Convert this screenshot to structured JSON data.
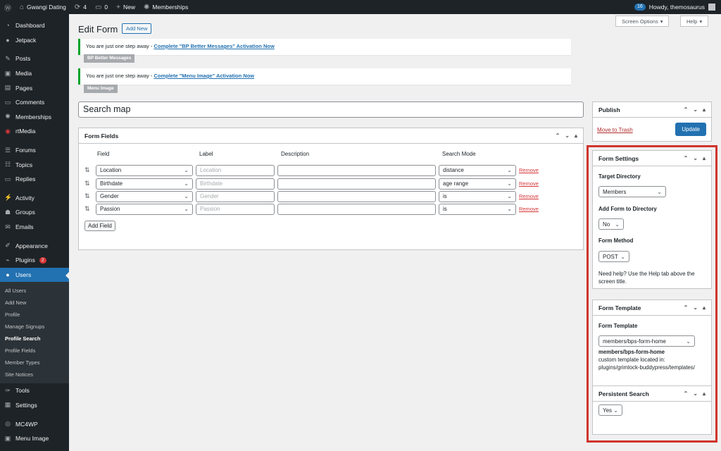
{
  "adminbar": {
    "site_name": "Gwangi Dating",
    "updates_count": "4",
    "comments_count": "0",
    "new_label": "New",
    "memberships_label": "Memberships",
    "notif_count": "16",
    "howdy": "Howdy, themosaurus"
  },
  "sidebar": {
    "items": [
      {
        "label": "Dashboard",
        "icon": "dashboard-icon"
      },
      {
        "label": "Jetpack",
        "icon": "jetpack-icon"
      },
      {
        "label": "Posts",
        "icon": "pin-icon"
      },
      {
        "label": "Media",
        "icon": "media-icon"
      },
      {
        "label": "Pages",
        "icon": "pages-icon"
      },
      {
        "label": "Comments",
        "icon": "comment-icon"
      },
      {
        "label": "Memberships",
        "icon": "memberships-icon"
      },
      {
        "label": "rtMedia",
        "icon": "rtmedia-icon"
      },
      {
        "label": "Forums",
        "icon": "forums-icon"
      },
      {
        "label": "Topics",
        "icon": "topics-icon"
      },
      {
        "label": "Replies",
        "icon": "replies-icon"
      },
      {
        "label": "Activity",
        "icon": "activity-icon"
      },
      {
        "label": "Groups",
        "icon": "groups-icon"
      },
      {
        "label": "Emails",
        "icon": "mail-icon"
      },
      {
        "label": "Appearance",
        "icon": "brush-icon"
      },
      {
        "label": "Plugins",
        "icon": "plugin-icon",
        "badge": "2"
      },
      {
        "label": "Users",
        "icon": "user-icon"
      }
    ],
    "submenu": [
      "All Users",
      "Add New",
      "Profile",
      "Manage Signups",
      "Profile Search",
      "Profile Fields",
      "Member Types",
      "Site Notices"
    ],
    "bottom": [
      {
        "label": "Tools",
        "icon": "wrench-icon"
      },
      {
        "label": "Settings",
        "icon": "settings-icon"
      },
      {
        "label": "MC4WP",
        "icon": "mc4wp-icon"
      },
      {
        "label": "Menu Image",
        "icon": "image-icon"
      }
    ]
  },
  "header": {
    "screen_options": "Screen Options",
    "help": "Help",
    "title": "Edit Form",
    "add_new": "Add New"
  },
  "notices": [
    {
      "text": "You are just one step away - ",
      "link": "Complete \"BP Better Messages\" Activation Now",
      "button": "BP Better Messages"
    },
    {
      "text": "You are just one step away - ",
      "link": "Complete \"Menu Image\" Activation Now",
      "button": "Menu Image"
    }
  ],
  "form_title": "Search map",
  "form_fields": {
    "heading": "Form Fields",
    "columns": [
      "Field",
      "Label",
      "Description",
      "Search Mode"
    ],
    "rows": [
      {
        "field": "Location",
        "label_placeholder": "Location",
        "mode": "distance"
      },
      {
        "field": "Birthdate",
        "label_placeholder": "Birthdate",
        "mode": "age range"
      },
      {
        "field": "Gender",
        "label_placeholder": "Gender",
        "mode": "is"
      },
      {
        "field": "Passion",
        "label_placeholder": "Passion",
        "mode": "is"
      }
    ],
    "remove_label": "Remove",
    "add_field": "Add Field"
  },
  "publish": {
    "heading": "Publish",
    "trash": "Move to Trash",
    "update": "Update"
  },
  "form_settings": {
    "heading": "Form Settings",
    "target_label": "Target Directory",
    "target_value": "Members",
    "add_label": "Add Form to Directory",
    "add_value": "No",
    "method_label": "Form Method",
    "method_value": "POST",
    "help": "Need help? Use the Help tab above the screen title."
  },
  "form_template": {
    "heading": "Form Template",
    "label": "Form Template",
    "value": "members/bps-form-home",
    "link": "members/bps-form-home",
    "desc1": "custom template located in:",
    "desc2": "plugins/grimlock-buddypress/templates/"
  },
  "persistent": {
    "heading": "Persistent Search",
    "value": "Yes"
  }
}
